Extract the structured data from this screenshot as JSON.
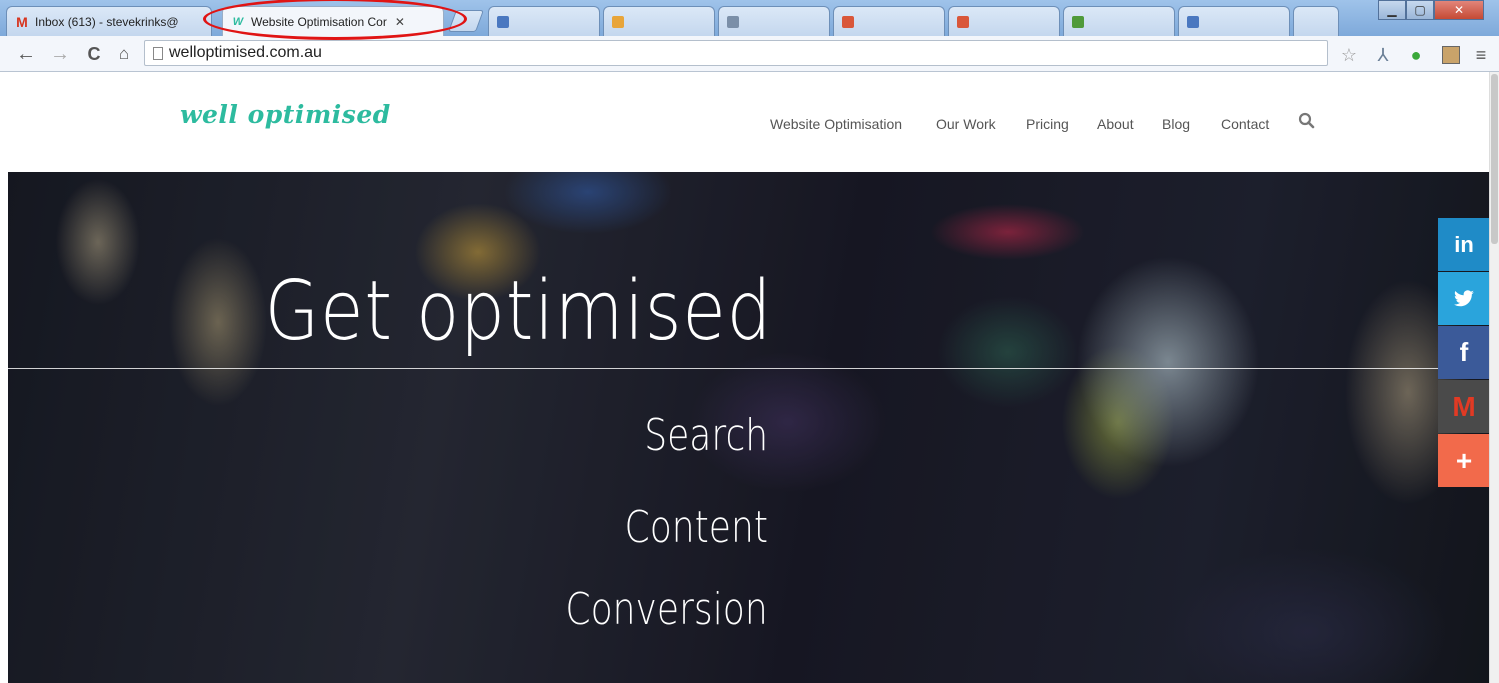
{
  "browser": {
    "tabs": [
      {
        "title": "Inbox (613) - stevekrinks@",
        "active": false
      },
      {
        "title": "Website Optimisation Cor",
        "active": true
      }
    ],
    "background_tabs_count": 8,
    "address": "welloptimised.com.au",
    "annotation_color": "#e01414"
  },
  "site": {
    "logo": "well optimised",
    "nav": [
      "Website Optimisation",
      "Our Work",
      "Pricing",
      "About",
      "Blog",
      "Contact"
    ],
    "accent": "#2dbb9f"
  },
  "hero": {
    "headline": "Get optimised",
    "lines": [
      "Search",
      "Content",
      "Conversion"
    ]
  },
  "share": [
    {
      "network": "linkedin",
      "label": "in",
      "color": "#1f8bc7"
    },
    {
      "network": "twitter",
      "icon": "twitter-icon",
      "color": "#2aa4dc"
    },
    {
      "network": "facebook",
      "label": "f",
      "color": "#3b5a99"
    },
    {
      "network": "gmail",
      "label": "M",
      "color": "#d7351f"
    },
    {
      "network": "more",
      "label": "+",
      "color": "#f26a4b"
    }
  ]
}
